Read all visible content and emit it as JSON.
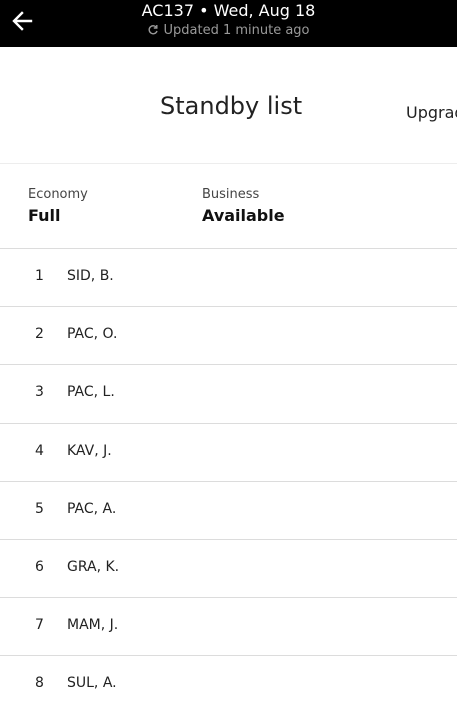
{
  "header": {
    "flight_title": "AC137 • Wed, Aug 18",
    "updated_text": "Updated 1 minute ago",
    "back_icon": "arrow-left-icon",
    "refresh_icon": "refresh-icon"
  },
  "tabs": {
    "standby_label": "Standby list",
    "upgrade_label": "Upgrade"
  },
  "cabins": {
    "economy": {
      "label": "Economy",
      "status": "Full"
    },
    "business": {
      "label": "Business",
      "status": "Available"
    }
  },
  "standby": [
    {
      "pos": "1",
      "name": "SID, B."
    },
    {
      "pos": "2",
      "name": "PAC, O."
    },
    {
      "pos": "3",
      "name": "PAC, L."
    },
    {
      "pos": "4",
      "name": "KAV, J."
    },
    {
      "pos": "5",
      "name": "PAC, A."
    },
    {
      "pos": "6",
      "name": "GRA, K."
    },
    {
      "pos": "7",
      "name": "MAM, J."
    },
    {
      "pos": "8",
      "name": "SUL, A."
    }
  ],
  "colors": {
    "topbar": "#000000",
    "divider": "#dcdcdc"
  }
}
